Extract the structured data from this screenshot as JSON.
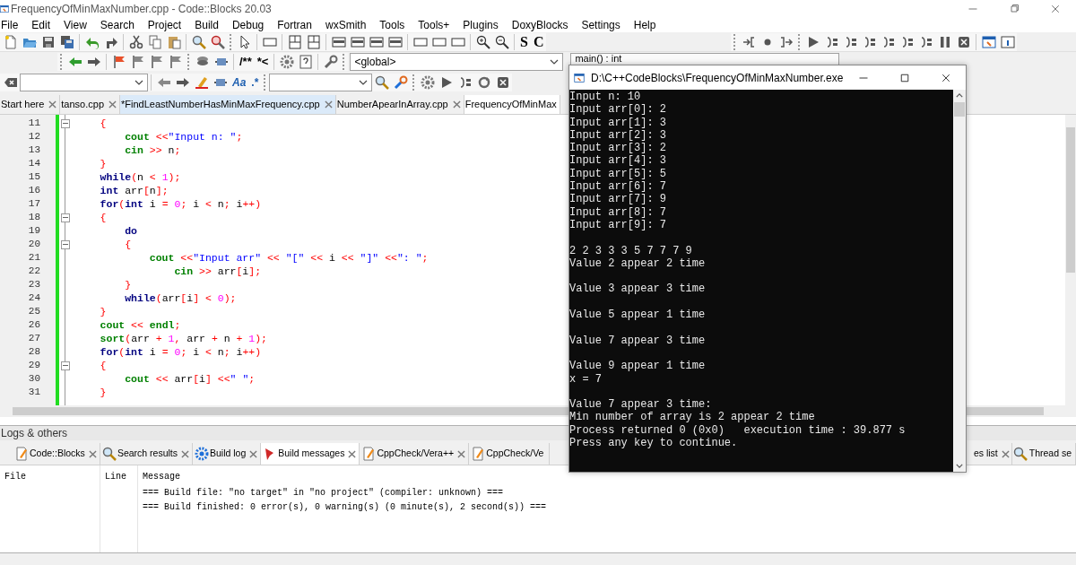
{
  "window": {
    "title": "FrequencyOfMinMaxNumber.cpp - Code::Blocks 20.03"
  },
  "menu": [
    "File",
    "Edit",
    "View",
    "Search",
    "Project",
    "Build",
    "Debug",
    "Fortran",
    "wxSmith",
    "Tools",
    "Tools+",
    "Plugins",
    "DoxyBlocks",
    "Settings",
    "Help"
  ],
  "toolbars": {
    "main_text_buttons": [
      "S",
      "C"
    ],
    "comment_text_buttons": [
      "/**",
      "*<"
    ],
    "search_text_buttons": [
      "Aa",
      ".*"
    ],
    "scope_combo": "<global>",
    "function_combo": "main() : int"
  },
  "editor_tabs": [
    {
      "label": "Start here",
      "selected": false,
      "hovered": false
    },
    {
      "label": "tanso.cpp",
      "selected": false,
      "hovered": false
    },
    {
      "label": "*FindLeastNumberHasMinMaxFrequency.cpp",
      "selected": false,
      "hovered": true
    },
    {
      "label": "NumberApearInArray.cpp",
      "selected": false,
      "hovered": false
    },
    {
      "label": "FrequencyOfMinMax",
      "selected": true,
      "hovered": false
    }
  ],
  "code": [
    {
      "number": "11",
      "fold": true,
      "tokens": [
        {
          "text": "    {",
          "kind": "op"
        }
      ]
    },
    {
      "number": "12",
      "fold": false,
      "tokens": [
        {
          "text": "        cout",
          "kind": "io"
        },
        {
          "text": " <<",
          "kind": "op"
        },
        {
          "text": "\"Input n: \"",
          "kind": "str"
        },
        {
          "text": ";",
          "kind": "op"
        }
      ]
    },
    {
      "number": "13",
      "fold": false,
      "tokens": [
        {
          "text": "        cin",
          "kind": "io"
        },
        {
          "text": " >> ",
          "kind": "op"
        },
        {
          "text": "n",
          "kind": "id"
        },
        {
          "text": ";",
          "kind": "op"
        }
      ]
    },
    {
      "number": "14",
      "fold": false,
      "tokens": [
        {
          "text": "    }",
          "kind": "op"
        }
      ]
    },
    {
      "number": "15",
      "fold": false,
      "tokens": [
        {
          "text": "    while",
          "kind": "kw"
        },
        {
          "text": "(",
          "kind": "op"
        },
        {
          "text": "n ",
          "kind": "id"
        },
        {
          "text": "< ",
          "kind": "op"
        },
        {
          "text": "1",
          "kind": "num"
        },
        {
          "text": ");",
          "kind": "op"
        }
      ]
    },
    {
      "number": "16",
      "fold": false,
      "tokens": [
        {
          "text": "    int",
          "kind": "kw"
        },
        {
          "text": " arr",
          "kind": "id"
        },
        {
          "text": "[",
          "kind": "op"
        },
        {
          "text": "n",
          "kind": "id"
        },
        {
          "text": "];",
          "kind": "op"
        }
      ]
    },
    {
      "number": "17",
      "fold": false,
      "tokens": [
        {
          "text": "    for",
          "kind": "kw"
        },
        {
          "text": "(",
          "kind": "op"
        },
        {
          "text": "int",
          "kind": "kw"
        },
        {
          "text": " i ",
          "kind": "id"
        },
        {
          "text": "= ",
          "kind": "op"
        },
        {
          "text": "0",
          "kind": "num"
        },
        {
          "text": "; ",
          "kind": "op"
        },
        {
          "text": "i ",
          "kind": "id"
        },
        {
          "text": "< ",
          "kind": "op"
        },
        {
          "text": "n",
          "kind": "id"
        },
        {
          "text": "; ",
          "kind": "op"
        },
        {
          "text": "i",
          "kind": "id"
        },
        {
          "text": "++)",
          "kind": "op"
        }
      ]
    },
    {
      "number": "18",
      "fold": true,
      "tokens": [
        {
          "text": "    {",
          "kind": "op"
        }
      ]
    },
    {
      "number": "19",
      "fold": false,
      "tokens": [
        {
          "text": "        do",
          "kind": "kw"
        }
      ]
    },
    {
      "number": "20",
      "fold": true,
      "tokens": [
        {
          "text": "        {",
          "kind": "op"
        }
      ]
    },
    {
      "number": "21",
      "fold": false,
      "tokens": [
        {
          "text": "            cout",
          "kind": "io"
        },
        {
          "text": " <<",
          "kind": "op"
        },
        {
          "text": "\"Input arr\"",
          "kind": "str"
        },
        {
          "text": " << ",
          "kind": "op"
        },
        {
          "text": "\"[\"",
          "kind": "str"
        },
        {
          "text": " << ",
          "kind": "op"
        },
        {
          "text": "i",
          "kind": "id"
        },
        {
          "text": " << ",
          "kind": "op"
        },
        {
          "text": "\"]\"",
          "kind": "str"
        },
        {
          "text": " <<",
          "kind": "op"
        },
        {
          "text": "\": \"",
          "kind": "str"
        },
        {
          "text": ";",
          "kind": "op"
        }
      ]
    },
    {
      "number": "22",
      "fold": false,
      "tokens": [
        {
          "text": "                cin",
          "kind": "io"
        },
        {
          "text": " >> ",
          "kind": "op"
        },
        {
          "text": "arr",
          "kind": "id"
        },
        {
          "text": "[",
          "kind": "op"
        },
        {
          "text": "i",
          "kind": "id"
        },
        {
          "text": "];",
          "kind": "op"
        }
      ]
    },
    {
      "number": "23",
      "fold": false,
      "tokens": [
        {
          "text": "        }",
          "kind": "op"
        }
      ]
    },
    {
      "number": "24",
      "fold": false,
      "tokens": [
        {
          "text": "        while",
          "kind": "kw"
        },
        {
          "text": "(",
          "kind": "op"
        },
        {
          "text": "arr",
          "kind": "id"
        },
        {
          "text": "[",
          "kind": "op"
        },
        {
          "text": "i",
          "kind": "id"
        },
        {
          "text": "] < ",
          "kind": "op"
        },
        {
          "text": "0",
          "kind": "num"
        },
        {
          "text": ");",
          "kind": "op"
        }
      ]
    },
    {
      "number": "25",
      "fold": false,
      "tokens": [
        {
          "text": "    }",
          "kind": "op"
        }
      ]
    },
    {
      "number": "26",
      "fold": false,
      "tokens": [
        {
          "text": "    cout",
          "kind": "io"
        },
        {
          "text": " << ",
          "kind": "op"
        },
        {
          "text": "endl",
          "kind": "io"
        },
        {
          "text": ";",
          "kind": "op"
        }
      ]
    },
    {
      "number": "27",
      "fold": false,
      "tokens": [
        {
          "text": "    sort",
          "kind": "io"
        },
        {
          "text": "(",
          "kind": "op"
        },
        {
          "text": "arr ",
          "kind": "id"
        },
        {
          "text": "+ ",
          "kind": "op"
        },
        {
          "text": "1",
          "kind": "num"
        },
        {
          "text": ", ",
          "kind": "op"
        },
        {
          "text": "arr ",
          "kind": "id"
        },
        {
          "text": "+ ",
          "kind": "op"
        },
        {
          "text": "n ",
          "kind": "id"
        },
        {
          "text": "+ ",
          "kind": "op"
        },
        {
          "text": "1",
          "kind": "num"
        },
        {
          "text": ");",
          "kind": "op"
        }
      ]
    },
    {
      "number": "28",
      "fold": false,
      "tokens": [
        {
          "text": "    for",
          "kind": "kw"
        },
        {
          "text": "(",
          "kind": "op"
        },
        {
          "text": "int",
          "kind": "kw"
        },
        {
          "text": " i ",
          "kind": "id"
        },
        {
          "text": "= ",
          "kind": "op"
        },
        {
          "text": "0",
          "kind": "num"
        },
        {
          "text": "; ",
          "kind": "op"
        },
        {
          "text": "i ",
          "kind": "id"
        },
        {
          "text": "< ",
          "kind": "op"
        },
        {
          "text": "n",
          "kind": "id"
        },
        {
          "text": "; ",
          "kind": "op"
        },
        {
          "text": "i",
          "kind": "id"
        },
        {
          "text": "++)",
          "kind": "op"
        }
      ]
    },
    {
      "number": "29",
      "fold": true,
      "tokens": [
        {
          "text": "    {",
          "kind": "op"
        }
      ]
    },
    {
      "number": "30",
      "fold": false,
      "tokens": [
        {
          "text": "        cout",
          "kind": "io"
        },
        {
          "text": " << ",
          "kind": "op"
        },
        {
          "text": "arr",
          "kind": "id"
        },
        {
          "text": "[",
          "kind": "op"
        },
        {
          "text": "i",
          "kind": "id"
        },
        {
          "text": "] <<",
          "kind": "op"
        },
        {
          "text": "\" \"",
          "kind": "str"
        },
        {
          "text": ";",
          "kind": "op"
        }
      ]
    },
    {
      "number": "31",
      "fold": false,
      "tokens": [
        {
          "text": "    }",
          "kind": "op"
        }
      ]
    }
  ],
  "logs_panel": {
    "title": "Logs & others",
    "tabs": [
      {
        "label": "Code::Blocks",
        "selected": false,
        "closable": true
      },
      {
        "label": "Search results",
        "selected": false,
        "closable": true
      },
      {
        "label": "Build log",
        "selected": false,
        "closable": true
      },
      {
        "label": "Build messages",
        "selected": true,
        "closable": true
      },
      {
        "label": "CppCheck/Vera++",
        "selected": false,
        "closable": true
      },
      {
        "label": "CppCheck/Ve",
        "selected": false,
        "closable": false
      }
    ],
    "tabs_right": [
      {
        "label": "es list",
        "closable": true
      },
      {
        "label": "Thread se",
        "closable": false
      }
    ],
    "columns": [
      "File",
      "Line",
      "Message"
    ],
    "rows": [
      {
        "message": "=== Build file: \"no target\" in \"no project\" (compiler: unknown) ==="
      },
      {
        "message": "=== Build finished: 0 error(s), 0 warning(s) (0 minute(s), 2 second(s)) ==="
      }
    ]
  },
  "console": {
    "title": "D:\\C++CodeBlocks\\FrequencyOfMinMaxNumber.exe",
    "blocks": [
      {
        "lines": [
          "Input n: 10",
          "Input arr[0]: 2",
          "Input arr[1]: 3",
          "Input arr[2]: 3",
          "Input arr[3]: 2",
          "Input arr[4]: 3",
          "Input arr[5]: 5",
          "Input arr[6]: 7",
          "Input arr[7]: 9",
          "Input arr[8]: 7",
          "Input arr[9]: 7"
        ]
      },
      {
        "lines": [
          "2 2 3 3 3 5 7 7 7 9",
          "Value 2 appear 2 time"
        ]
      },
      {
        "lines": [
          "Value 3 appear 3 time"
        ]
      },
      {
        "lines": [
          "Value 5 appear 1 time"
        ]
      },
      {
        "lines": [
          "Value 7 appear 3 time"
        ]
      },
      {
        "lines": [
          "Value 9 appear 1 time",
          "x = 7"
        ]
      },
      {
        "lines": [
          "Value 7 appear 3 time:",
          "Min number of array is 2 appear 2 time",
          "Process returned 0 (0x0)   execution time : 39.877 s",
          "Press any key to continue."
        ]
      }
    ]
  }
}
